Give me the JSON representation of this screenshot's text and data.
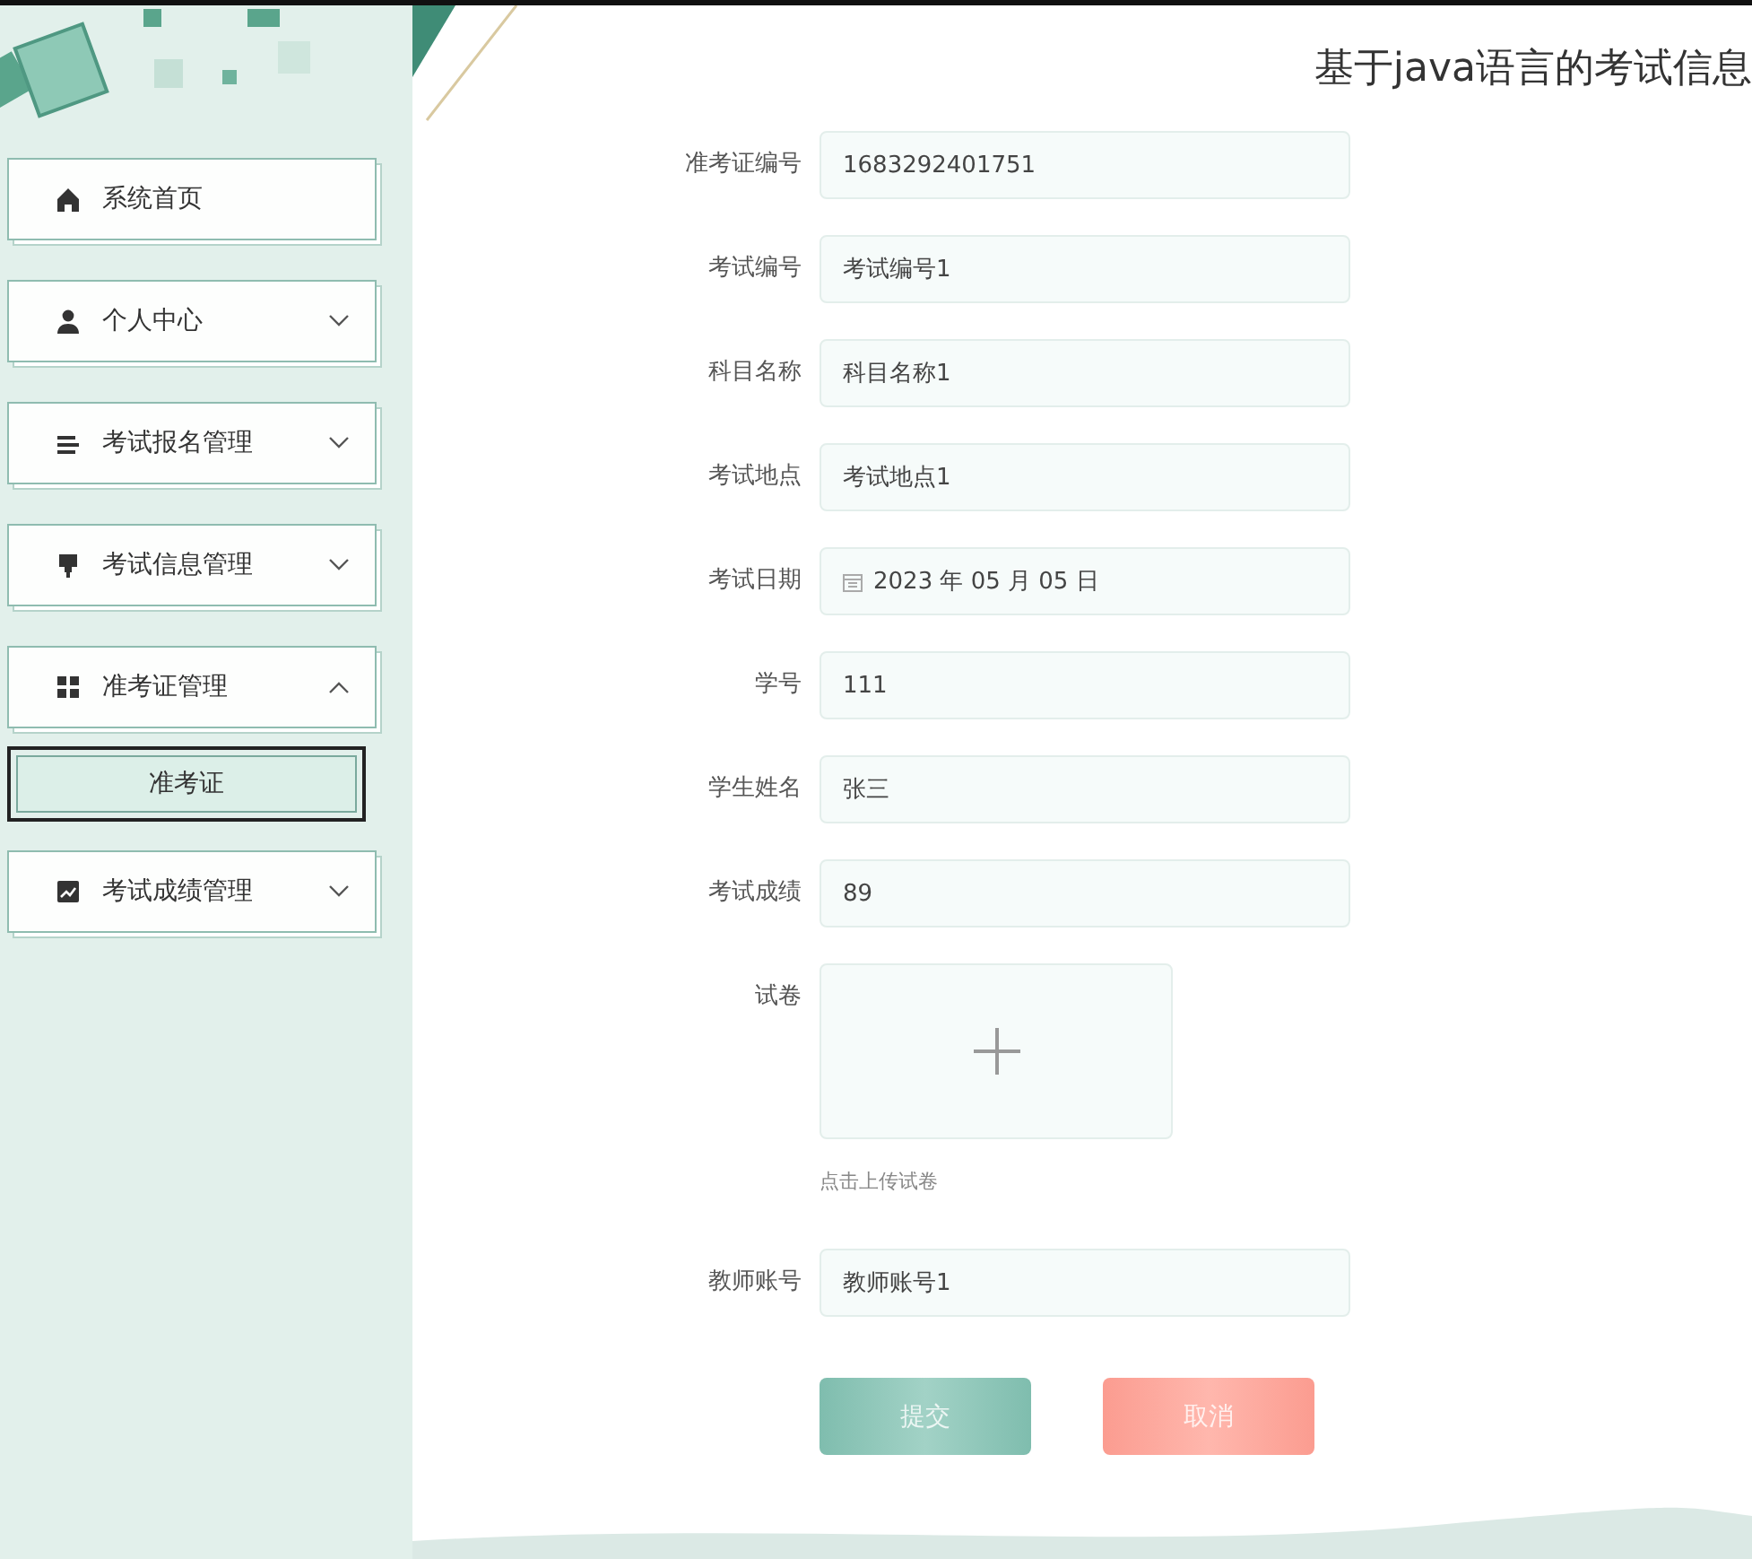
{
  "header": {
    "title": "基于java语言的考试信息"
  },
  "sidebar": {
    "items": [
      {
        "kind": "link",
        "label": "系统首页"
      },
      {
        "kind": "group",
        "label": "个人中心",
        "expanded": false
      },
      {
        "kind": "group",
        "label": "考试报名管理",
        "expanded": false
      },
      {
        "kind": "group",
        "label": "考试信息管理",
        "expanded": false
      },
      {
        "kind": "group",
        "label": "准考证管理",
        "expanded": true,
        "children": [
          {
            "label": "准考证",
            "selected": true
          }
        ]
      },
      {
        "kind": "group",
        "label": "考试成绩管理",
        "expanded": false
      }
    ]
  },
  "form": {
    "fields": [
      {
        "kind": "text",
        "label": "准考证编号",
        "value": "1683292401751"
      },
      {
        "kind": "text",
        "label": "考试编号",
        "value": "考试编号1"
      },
      {
        "kind": "text",
        "label": "科目名称",
        "value": "科目名称1"
      },
      {
        "kind": "text",
        "label": "考试地点",
        "value": "考试地点1"
      },
      {
        "kind": "date",
        "label": "考试日期",
        "value": "2023 年 05 月 05 日"
      },
      {
        "kind": "text",
        "label": "学号",
        "value": "111"
      },
      {
        "kind": "text",
        "label": "学生姓名",
        "value": "张三"
      },
      {
        "kind": "text",
        "label": "考试成绩",
        "value": "89"
      },
      {
        "kind": "upload",
        "label": "试卷",
        "hint": "点击上传试卷"
      },
      {
        "kind": "text",
        "label": "教师账号",
        "value": "教师账号1"
      }
    ],
    "buttons": [
      {
        "kind": "submit",
        "label": "提交"
      },
      {
        "kind": "cancel",
        "label": "取消"
      }
    ]
  }
}
